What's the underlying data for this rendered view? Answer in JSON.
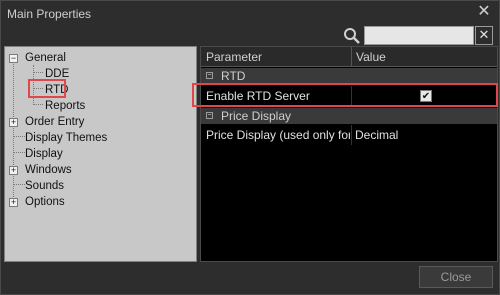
{
  "window": {
    "title": "Main Properties"
  },
  "icons": {
    "close": "close-icon",
    "search": "search-icon",
    "clear": "clear-icon"
  },
  "search": {
    "value": "",
    "clear_label": "✕"
  },
  "tree": {
    "items": [
      {
        "label": "General",
        "expander": "−"
      },
      {
        "label": "DDE"
      },
      {
        "label": "RTD"
      },
      {
        "label": "Reports"
      },
      {
        "label": "Order Entry",
        "expander": "+"
      },
      {
        "label": "Display Themes"
      },
      {
        "label": "Display"
      },
      {
        "label": "Windows",
        "expander": "+"
      },
      {
        "label": "Sounds"
      },
      {
        "label": "Options",
        "expander": "+"
      }
    ]
  },
  "grid": {
    "headers": {
      "parameter": "Parameter",
      "value": "Value"
    },
    "groups": [
      {
        "label": "RTD",
        "toggle": "−"
      },
      {
        "label": "Price Display",
        "toggle": "−"
      }
    ],
    "rows": [
      {
        "name": "Enable RTD Server",
        "value": "",
        "checked": true,
        "check_glyph": "✔"
      },
      {
        "name": "Price Display (used only for",
        "value": "Decimal"
      }
    ]
  },
  "footer": {
    "close_label": "Close"
  },
  "colors": {
    "highlight": "#e0464a",
    "tree_bg": "#c8c8c8",
    "grid_bg": "#000000"
  }
}
